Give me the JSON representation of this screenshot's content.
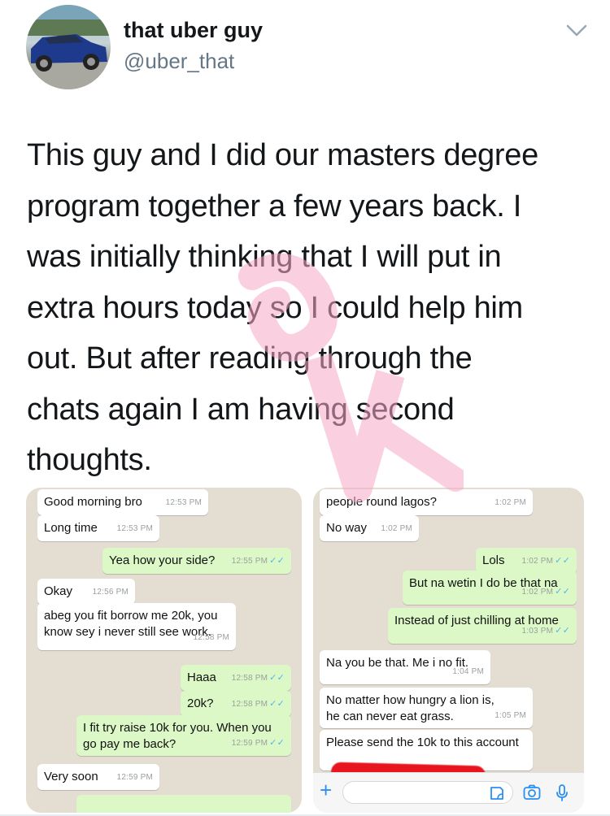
{
  "tweet": {
    "display_name": "that uber guy",
    "handle": "@uber_that",
    "text_lines": [
      "This guy and I did our masters degree",
      "program together a few years back. I",
      "was initially thinking that I will put in",
      "extra hours today so I could help him",
      "out. But after reading through the",
      "chats again I am having second",
      "thoughts."
    ]
  },
  "chat_left": {
    "messages": [
      {
        "dir": "in",
        "text": "Good morning bro",
        "time": "12:53 PM"
      },
      {
        "dir": "in",
        "text": "Long time",
        "time": "12:53 PM"
      },
      {
        "dir": "out",
        "text": "Yea how your side?",
        "time": "12:55 PM"
      },
      {
        "dir": "in",
        "text": "Okay",
        "time": "12:56 PM"
      },
      {
        "dir": "in",
        "text": "abeg you fit borrow me 20k, you know sey i never still see work.",
        "time": "12:58 PM"
      },
      {
        "dir": "out",
        "text": "Haaa",
        "time": "12:58 PM"
      },
      {
        "dir": "out",
        "text": "20k?",
        "time": "12:58 PM"
      },
      {
        "dir": "out",
        "text": "I fit try raise 10k for you. When you go pay me back?",
        "time": "12:59 PM"
      },
      {
        "dir": "in",
        "text": "Very soon",
        "time": "12:59 PM"
      }
    ]
  },
  "chat_right": {
    "messages": [
      {
        "dir": "in",
        "text": "people round lagos?",
        "time": "1:02 PM"
      },
      {
        "dir": "in",
        "text": "No way",
        "time": "1:02 PM"
      },
      {
        "dir": "out",
        "text": "Lols",
        "time": "1:02 PM"
      },
      {
        "dir": "out",
        "text": "But na wetin I do be that na",
        "time": "1:02 PM"
      },
      {
        "dir": "out",
        "text": "Instead of just chilling at home",
        "time": "1:03 PM"
      },
      {
        "dir": "in",
        "text": "Na you be that. Me i no fit.",
        "time": "1:04 PM"
      },
      {
        "dir": "in",
        "text": "No matter how hungry a lion is, he can never eat grass.",
        "time": "1:05 PM"
      },
      {
        "dir": "in",
        "text": "Please send the 10k to this account",
        "time": ""
      }
    ],
    "input_plus": "+"
  },
  "icons": {
    "caret": "chevron-down-icon",
    "double_tick": "✓✓",
    "sticker": "sticker-icon",
    "camera": "camera-icon",
    "mic": "microphone-icon"
  },
  "colors": {
    "outgoing_bubble": "#dcf8c6",
    "incoming_bubble": "#ffffff",
    "chat_background": "#e4ddd2",
    "read_ticks": "#4fb6ec",
    "watermark": "#f7a9c7",
    "redaction": "#e8151f"
  }
}
